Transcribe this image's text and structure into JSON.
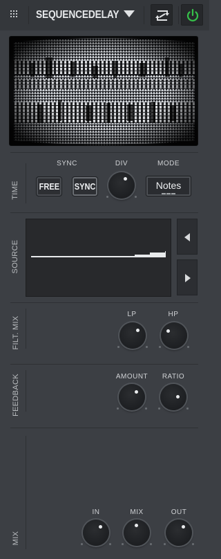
{
  "header": {
    "title": "SEQUENCEDELAY",
    "menu_icon": "grip-icon",
    "dropdown_icon": "triangle-down-icon",
    "swap_icon": "swap-icon",
    "power_icon": "power-icon",
    "power_color": "#36c24a"
  },
  "time": {
    "label": "TIME",
    "sync_label": "SYNC",
    "free_button": "FREE",
    "sync_button": "SYNC",
    "div_label": "DIV",
    "mode_label": "MODE",
    "mode_value": "Notes"
  },
  "source": {
    "label": "SOURCE",
    "prev_icon": "arrow-left-icon",
    "next_icon": "arrow-right-icon"
  },
  "filt_mix": {
    "label": "FILT. MIX",
    "lp_label": "LP",
    "hp_label": "HP"
  },
  "feedback": {
    "label": "FEEDBACK",
    "amount_label": "AMOUNT",
    "ratio_label": "RATIO"
  },
  "mix": {
    "label": "MIX",
    "in_label": "IN",
    "mix_label": "MIX",
    "out_label": "OUT"
  }
}
